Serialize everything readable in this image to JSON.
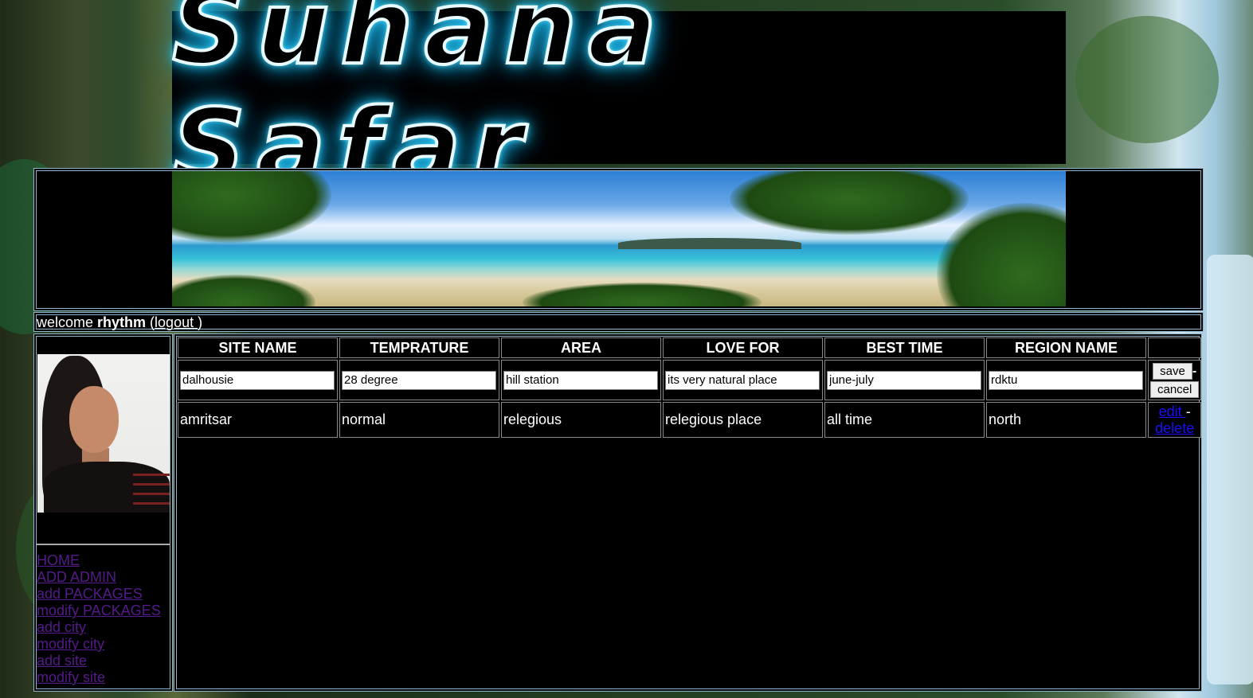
{
  "header": {
    "logo_text": "Suhana Safar"
  },
  "welcome": {
    "prefix": "welcome ",
    "user": "rhythm",
    "open_paren": " (",
    "logout": "logout ",
    "close_paren": ")"
  },
  "menu": [
    "HOME",
    "ADD ADMIN",
    "add PACKAGES",
    "modify PACKAGES",
    "add city",
    "modify city",
    "add site",
    "modify site"
  ],
  "table": {
    "headers": [
      "SITE NAME",
      "TEMPRATURE",
      "AREA",
      "LOVE FOR",
      "BEST TIME",
      "REGION NAME"
    ],
    "edit_row": [
      "dalhousie",
      "28 degree",
      "hill station",
      "its very natural place",
      "june-july",
      "rdktu"
    ],
    "save_label": "save",
    "cancel_label": "cancel",
    "edit_dash": "-",
    "rows": [
      {
        "cells": [
          "amritsar",
          "normal",
          "relegious",
          "relegious place",
          "all time",
          "north"
        ],
        "edit_label": "edit ",
        "dash": "-",
        "delete_label": "delete"
      }
    ]
  },
  "colors": {
    "panel_border": "#8fb6cc",
    "visited_link": "#551a8b",
    "link": "#1a0dff",
    "logo_glow": "#2fcfff"
  }
}
